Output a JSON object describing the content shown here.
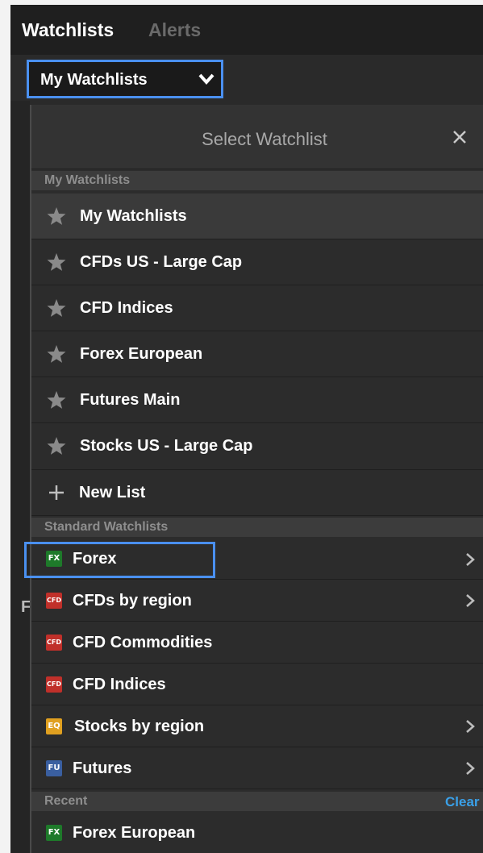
{
  "header": {
    "tab_watchlists": "Watchlists",
    "tab_alerts": "Alerts",
    "selector_value": "My Watchlists"
  },
  "background": {
    "partial_label": "F"
  },
  "dialog": {
    "title": "Select Watchlist",
    "close_icon": "close-icon",
    "my_section_label": "My Watchlists",
    "my_items": [
      {
        "label": "My Watchlists",
        "icon": "star-icon"
      },
      {
        "label": "CFDs US - Large Cap",
        "icon": "star-icon"
      },
      {
        "label": "CFD Indices",
        "icon": "star-icon"
      },
      {
        "label": "Forex European",
        "icon": "star-icon"
      },
      {
        "label": "Futures Main",
        "icon": "star-icon"
      },
      {
        "label": "Stocks US - Large Cap",
        "icon": "star-icon"
      }
    ],
    "new_list_label": "New List",
    "standard_section_label": "Standard Watchlists",
    "standard_items": [
      {
        "label": "Forex",
        "badge": "FX",
        "badge_color": "#1e7a2a",
        "has_submenu": true
      },
      {
        "label": "CFDs by region",
        "badge": "CFD",
        "badge_color": "#c0302a",
        "has_submenu": true
      },
      {
        "label": "CFD Commodities",
        "badge": "CFD",
        "badge_color": "#c0302a",
        "has_submenu": false
      },
      {
        "label": "CFD Indices",
        "badge": "CFD",
        "badge_color": "#c0302a",
        "has_submenu": false
      },
      {
        "label": "Stocks by region",
        "badge": "EQ",
        "badge_color": "#e0a020",
        "has_submenu": true
      },
      {
        "label": "Futures",
        "badge": "FU",
        "badge_color": "#3a5fa0",
        "has_submenu": true
      }
    ],
    "recent_section_label": "Recent",
    "clear_label": "Clear",
    "recent_items": [
      {
        "label": "Forex European",
        "badge": "FX",
        "badge_color": "#1e7a2a"
      }
    ]
  },
  "colors": {
    "highlight": "#4a90f0",
    "link": "#3aa0e8"
  }
}
